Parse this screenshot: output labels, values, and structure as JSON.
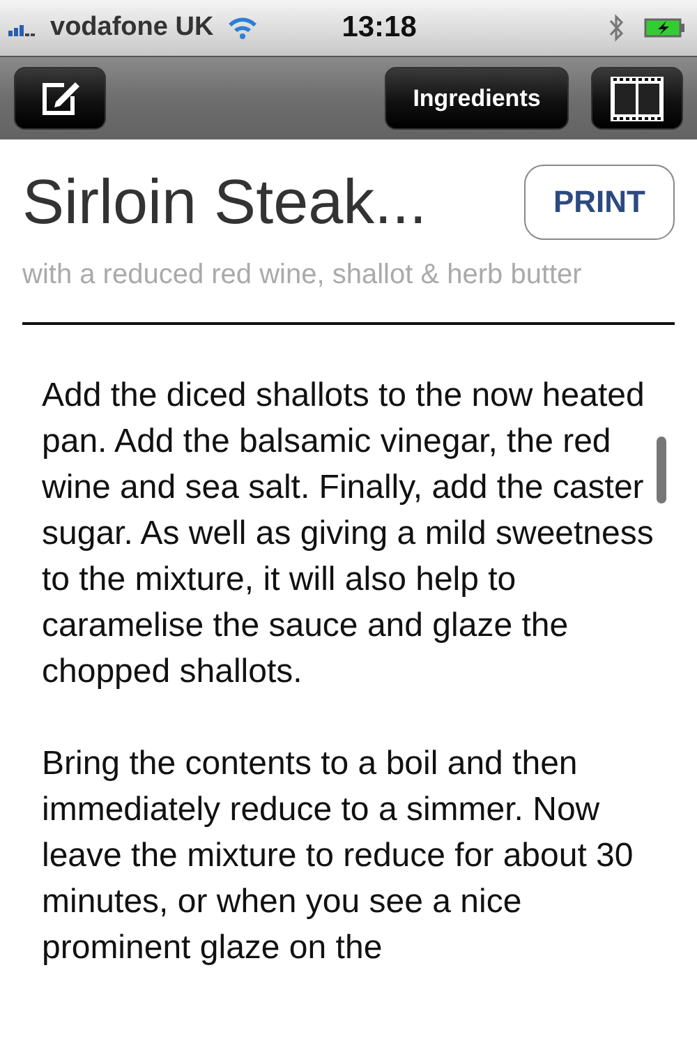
{
  "status_bar": {
    "carrier": "vodafone UK",
    "time": "13:18"
  },
  "toolbar": {
    "buttons": [
      {
        "label": "Ingredients"
      }
    ]
  },
  "recipe": {
    "title": "Sirloin Steak...",
    "print_button": "PRINT",
    "subtitle": "with a reduced red wine, shallot & herb butter",
    "paragraphs": [
      "Add the diced shallots to the now heated pan. Add the balsamic vinegar, the red wine and sea salt. Finally, add the caster sugar. As well as giving a mild sweetness to the mixture, it will also help to caramelise the sauce and glaze the chopped shallots.",
      "Bring the contents to a boil and then immediately reduce to a simmer. Now leave the mixture to reduce for about 30 minutes, or when you see a nice prominent glaze on the"
    ]
  }
}
